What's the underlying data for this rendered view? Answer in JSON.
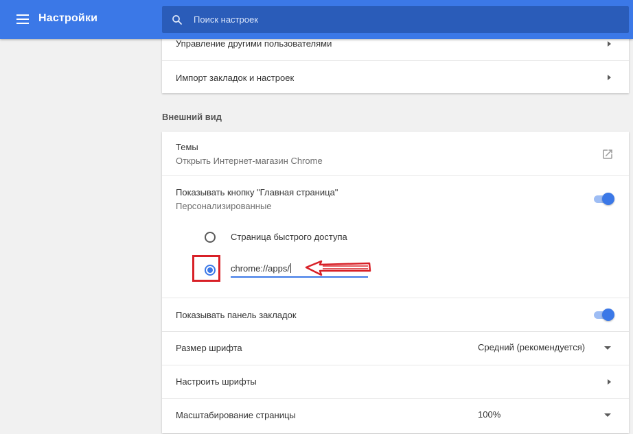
{
  "header": {
    "title": "Настройки",
    "search_placeholder": "Поиск настроек",
    "accent_color": "#3b78e7"
  },
  "people_card": {
    "items": [
      {
        "label": "Управление другими пользователями"
      },
      {
        "label": "Импорт закладок и настроек"
      }
    ]
  },
  "appearance": {
    "section_title": "Внешний вид",
    "themes": {
      "label": "Темы",
      "sublabel": "Открыть Интернет-магазин Chrome",
      "icon": "open-in-new-icon"
    },
    "home_button": {
      "label": "Показывать кнопку \"Главная страница\"",
      "sublabel": "Персонализированные",
      "enabled": true,
      "options": [
        {
          "label": "Страница быстрого доступа",
          "checked": false
        },
        {
          "value": "chrome://apps/",
          "checked": true
        }
      ]
    },
    "bookmarks_bar": {
      "label": "Показывать панель закладок",
      "enabled": true
    },
    "font_size": {
      "label": "Размер шрифта",
      "value": "Средний (рекомендуется)"
    },
    "customize_fonts": {
      "label": "Настроить шрифты"
    },
    "page_zoom": {
      "label": "Масштабирование страницы",
      "value": "100%"
    }
  },
  "annotation": {
    "highlight_color": "#d82027"
  }
}
